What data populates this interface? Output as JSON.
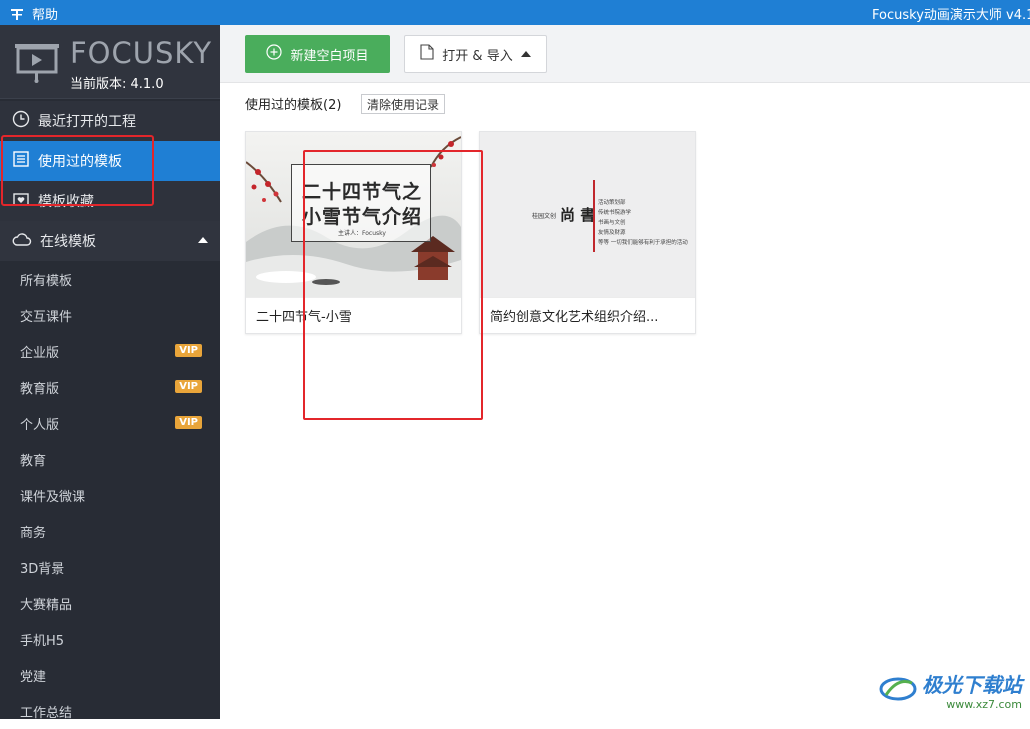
{
  "topbar": {
    "help_label": "帮助",
    "app_title": "Focusky动画演示大师 v4.1"
  },
  "sidebar": {
    "logo_text": "FOCUSKY",
    "version": "当前版本: 4.1.0",
    "nav": {
      "recent": "最近打开的工程",
      "used": "使用过的模板",
      "favorites": "模板收藏",
      "online": "在线模板"
    },
    "sub_items": [
      {
        "label": "所有模板",
        "vip": ""
      },
      {
        "label": "交互课件",
        "vip": ""
      },
      {
        "label": "企业版",
        "vip": "VIP"
      },
      {
        "label": "教育版",
        "vip": "VIP"
      },
      {
        "label": "个人版",
        "vip": "VIP"
      },
      {
        "label": "教育",
        "vip": ""
      },
      {
        "label": "课件及微课",
        "vip": ""
      },
      {
        "label": "商务",
        "vip": ""
      },
      {
        "label": "3D背景",
        "vip": ""
      },
      {
        "label": "大赛精品",
        "vip": ""
      },
      {
        "label": "手机H5",
        "vip": ""
      },
      {
        "label": "党建",
        "vip": ""
      },
      {
        "label": "工作总结",
        "vip": ""
      }
    ]
  },
  "toolbar": {
    "new_label": "新建空白项目",
    "open_label": "打开 & 导入"
  },
  "main": {
    "section_title": "使用过的模板(2)",
    "clear_label": "清除使用记录",
    "templates": [
      {
        "name": "二十四节气-小雪",
        "thumb_line1": "二十四节气之",
        "thumb_line2": "小雪节气介绍",
        "thumb_small": "主讲人：Focusky"
      },
      {
        "name": "简约创意文化艺术组织介绍...",
        "thumb_small_title": "桂园文创",
        "thumb_big": "尚 書",
        "thumb_lines": [
          "活动策划部",
          "传统书院游学",
          "书画与文创",
          "友情及财源",
          "等等 一切我们能够有利于承担的活动"
        ]
      }
    ]
  },
  "watermark": {
    "brand": "极光下载站",
    "url": "www.xz7.com"
  },
  "colors": {
    "accent": "#1f7fd4",
    "sidebar_bg": "#282c35",
    "new_btn": "#4aad5c",
    "vip": "#e9a53a",
    "highlight_box": "#e3262b"
  }
}
